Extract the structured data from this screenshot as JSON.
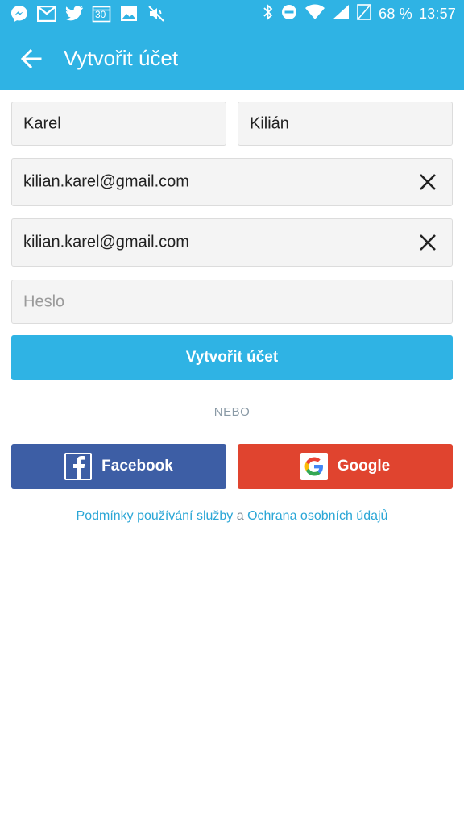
{
  "status_bar": {
    "battery_text": "68 %",
    "time": "13:57",
    "left_icons": [
      "messenger-icon",
      "gmail-icon",
      "twitter-icon",
      "calendar-icon",
      "gallery-icon",
      "mute-icon"
    ],
    "calendar_day": "30",
    "right_icons": [
      "bluetooth-icon",
      "do-not-disturb-icon",
      "wifi-icon",
      "signal-icon",
      "battery-icon"
    ]
  },
  "app_bar": {
    "title": "Vytvořit účet",
    "back_icon": "arrow-left-icon"
  },
  "form": {
    "first_name": "Karel",
    "last_name": "Kilián",
    "email": "kilian.karel@gmail.com",
    "email_confirm": "kilian.karel@gmail.com",
    "password_placeholder": "Heslo",
    "submit_label": "Vytvořit účet"
  },
  "divider_text": "NEBO",
  "social": {
    "facebook_label": "Facebook",
    "google_label": "Google"
  },
  "terms": {
    "link1": "Podmínky používání služby",
    "conjunction": "a",
    "link2": "Ochrana osobních údajů"
  },
  "colors": {
    "primary": "#2fb3e4",
    "facebook": "#3d5ea5",
    "google": "#e0442f",
    "link": "#2aa6d6"
  }
}
